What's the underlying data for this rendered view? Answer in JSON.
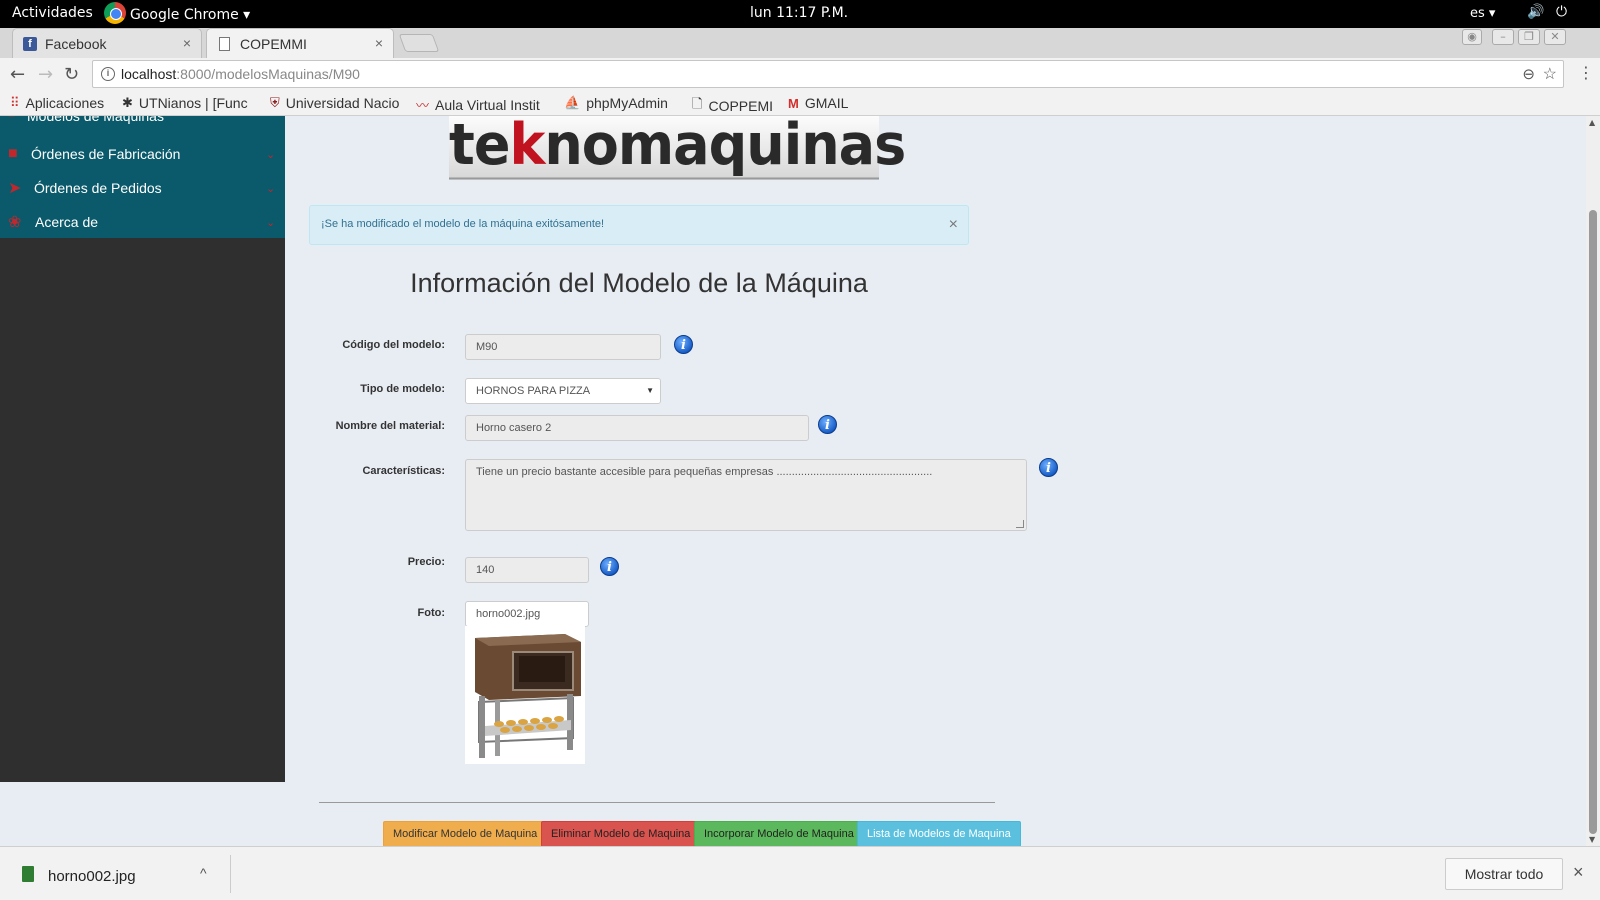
{
  "topbar": {
    "activities": "Actividades",
    "app_menu": "Google Chrome ▾",
    "clock": "lun 11:17 P.M.",
    "language": "es ▾",
    "volume_icon": "🔊",
    "power_icon": "⏻"
  },
  "tabs": [
    {
      "label": "Facebook",
      "close": "×"
    },
    {
      "label": "COPEMMI",
      "close": "×"
    }
  ],
  "toolbar": {
    "back": "←",
    "forward": "→",
    "reload": "↻",
    "url_host": "localhost",
    "url_rest": ":8000/modelosMaquinas/M90",
    "info": "i",
    "zoom_icon": "⊖",
    "star_icon": "☆",
    "menu_icon": "⋮"
  },
  "bookmarks": [
    {
      "label": "Aplicaciones",
      "icon": "⠿"
    },
    {
      "label": "UTNianos | [Func",
      "icon": "✱"
    },
    {
      "label": "Universidad Nacio",
      "icon": "⛨"
    },
    {
      "label": "Aula Virtual Instit",
      "icon": "〰"
    },
    {
      "label": "phpMyAdmin",
      "icon": "⛵"
    },
    {
      "label": "COPPEMI",
      "icon": "🗋"
    },
    {
      "label": "GMAIL",
      "icon": "M"
    }
  ],
  "sidebar": {
    "items": [
      {
        "label": "Modelos de Máquinas",
        "icon": "■"
      },
      {
        "label": "Órdenes de Fabricación",
        "icon": "■"
      },
      {
        "label": "Órdenes de Pedidos",
        "icon": "➤"
      },
      {
        "label": "Acerca de",
        "icon": "❀"
      }
    ],
    "caret": "⌄"
  },
  "main": {
    "logo_pre": "te",
    "logo_k": "k",
    "logo_post": "nomaquinas",
    "alert": "¡Se ha modificado el modelo de la máquina exitósamente!",
    "alert_close": "×",
    "title": "Información del Modelo de la Máquina",
    "fields": {
      "codigo_label": "Código del modelo:",
      "codigo_value": "M90",
      "tipo_label": "Tipo de modelo:",
      "tipo_value": "HORNOS PARA PIZZA",
      "nombre_label": "Nombre del material:",
      "nombre_value": "Horno casero 2",
      "caract_label": "Características:",
      "caract_value": "Tiene un precio bastante accesible para pequeñas empresas ...................................................",
      "precio_label": "Precio:",
      "precio_value": "140",
      "foto_label": "Foto:",
      "foto_value": "horno002.jpg"
    },
    "help_glyph": "i",
    "buttons": {
      "modificar": "Modificar Modelo de Maquina",
      "eliminar": "Eliminar Modelo de Maquina",
      "incorporar": "Incorporar Modelo de Maquina",
      "lista": "Lista de Modelos de Maquina"
    }
  },
  "downloads": {
    "filename": "horno002.jpg",
    "chevron": "^",
    "show_all": "Mostrar todo",
    "close": "×"
  }
}
